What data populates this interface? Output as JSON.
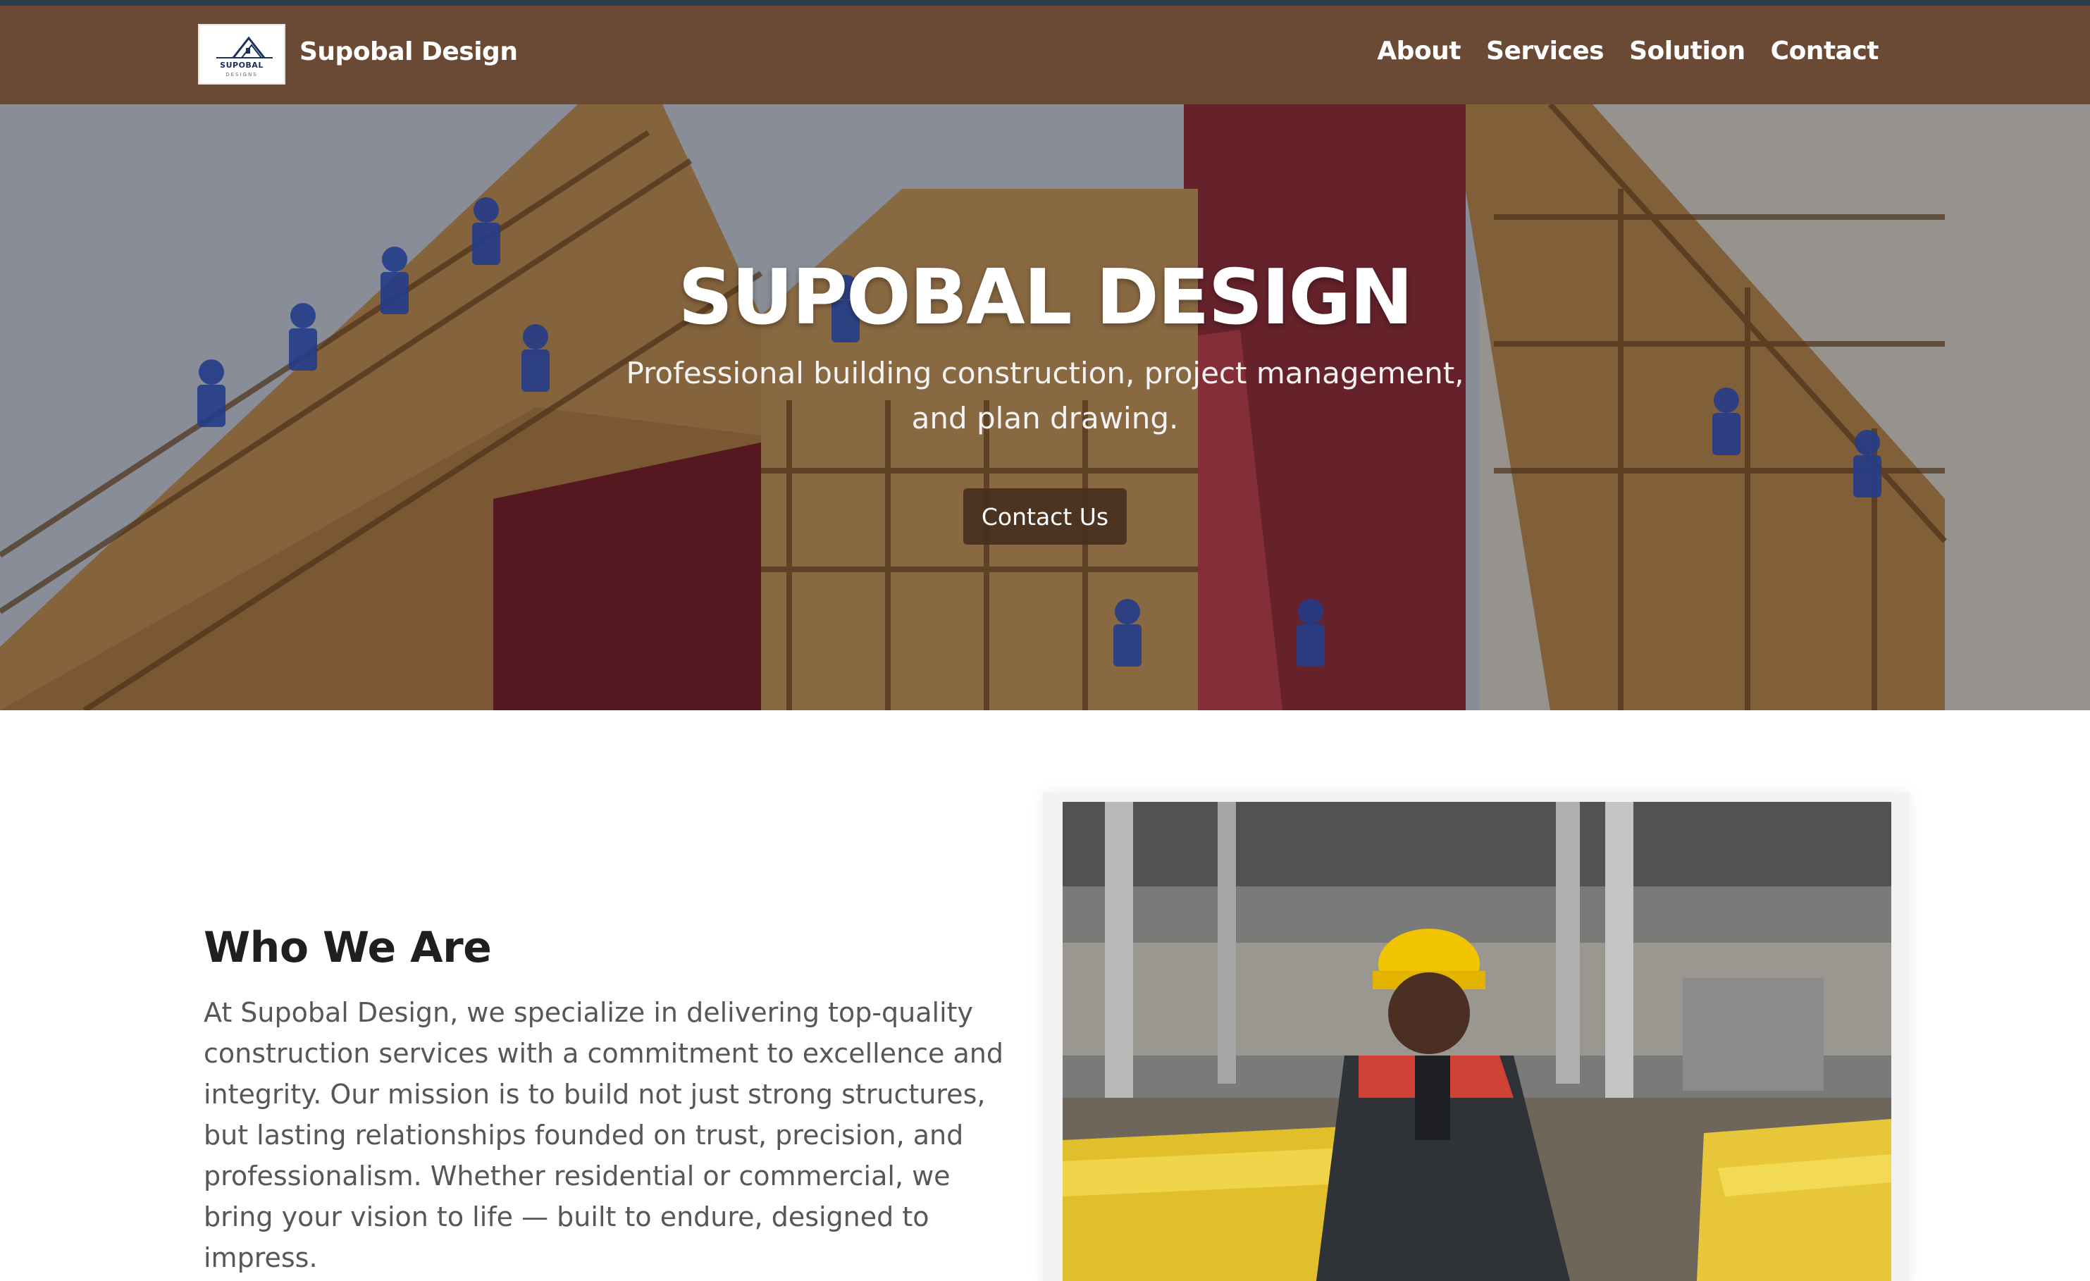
{
  "header": {
    "logo_text": "SUPOBAL",
    "logo_subtext": "DESIGNS",
    "brand_name": "Supobal Design",
    "nav": [
      "About",
      "Services",
      "Solution",
      "Contact"
    ]
  },
  "hero": {
    "title": "SUPOBAL DESIGN",
    "subtitle": "Professional building construction, project management, and plan drawing.",
    "cta_label": "Contact Us"
  },
  "who": {
    "title": "Who We Are",
    "text": "At Supobal Design, we specialize in delivering top-quality construction services with a commitment to excellence and integrity. Our mission is to build not just strong structures, but lasting relationships founded on trust, precision, and professionalism. Whether residential or commercial, we bring your vision to life — built to endure, designed to impress."
  },
  "colors": {
    "header_bg": "#6a4a35",
    "accent_line": "#2a3b4a",
    "button_bg": "#46301e",
    "text_dark": "#1f1f1f",
    "text_body": "#575757"
  }
}
